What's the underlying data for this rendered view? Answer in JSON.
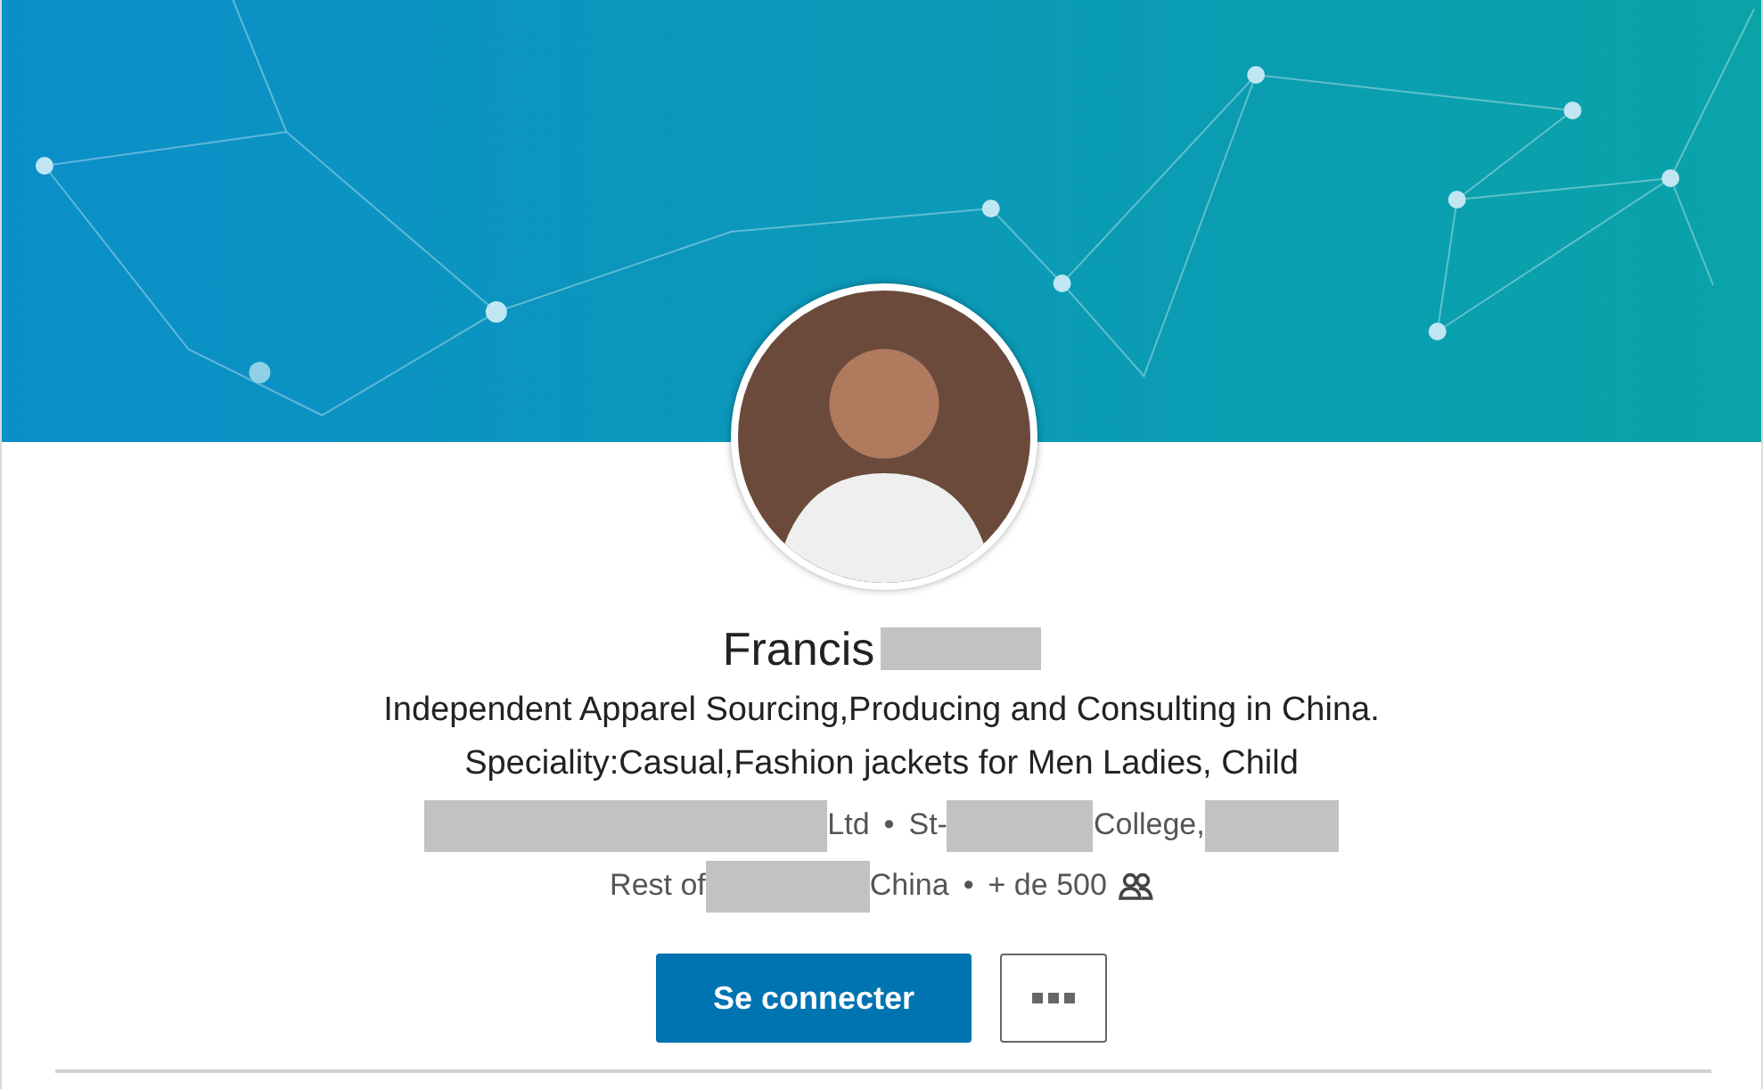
{
  "profile": {
    "name": [
      {
        "kind": "text",
        "text": "Francis"
      },
      {
        "kind": "redacted"
      }
    ],
    "headline": [
      "Independent Apparel Sourcing,Producing and Consulting in China.",
      "Speciality:Casual,Fashion jackets for Men Ladies, Child"
    ],
    "experience": [
      {
        "kind": "redacted"
      },
      {
        "kind": "text",
        "text": "Ltd"
      },
      {
        "kind": "separator",
        "text": "•"
      },
      {
        "kind": "text",
        "text": "St-"
      },
      {
        "kind": "redacted"
      },
      {
        "kind": "text",
        "text": "College,"
      },
      {
        "kind": "redacted"
      }
    ],
    "location": [
      {
        "kind": "text",
        "text": "Rest of"
      },
      {
        "kind": "redacted"
      },
      {
        "kind": "text",
        "text": "China"
      },
      {
        "kind": "separator",
        "text": "•"
      },
      {
        "kind": "text",
        "text": "+ de 500"
      },
      {
        "kind": "connections-icon"
      }
    ],
    "buttons": [
      {
        "kind": "primary",
        "label": "Se connecter"
      },
      {
        "kind": "more"
      }
    ]
  }
}
